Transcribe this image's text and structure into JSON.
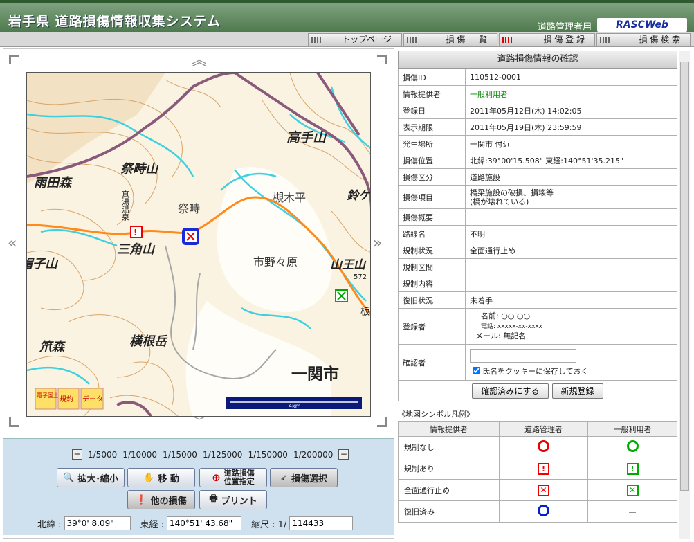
{
  "header": {
    "title": "岩手県 道路損傷情報収集システム",
    "role": "道路管理者用",
    "logo": "RASCWeb"
  },
  "nav": [
    "トップページ",
    "損 傷 一 覧",
    "損 傷 登 録",
    "損 傷 検 索"
  ],
  "map": {
    "labels": [
      "高手山",
      "雨田森",
      "祭畤山",
      "槻木平",
      "鈴ケ",
      "真湯温泉",
      "祭畤",
      "三角山",
      "帽子山",
      "市野々原",
      "山王山",
      "572",
      "板",
      "笊森",
      "横根岳",
      "一関市"
    ],
    "badges": [
      "電子国土",
      "規約",
      "データ"
    ],
    "scale_bar": "4km"
  },
  "scales": [
    "1/5000",
    "1/10000",
    "1/15000",
    "1/125000",
    "1/150000",
    "1/200000"
  ],
  "tools": {
    "zoom": "拡大･縮小",
    "move": "移 動",
    "pos_line1": "道路損傷",
    "pos_line2": "位置指定",
    "select": "損傷選択",
    "other": "他の損傷",
    "print": "プリント"
  },
  "coords": {
    "lat_label": "北緯 :",
    "lat": "39°0' 8.09\"",
    "lon_label": "東経 :",
    "lon": "140°51' 43.68\"",
    "scale_label": "縮尺 : 1/",
    "scale": "114433"
  },
  "info": {
    "title": "道路損傷情報の確認",
    "rows": [
      {
        "k": "損傷ID",
        "v": "110512-0001"
      },
      {
        "k": "情報提供者",
        "v": "一般利用者"
      },
      {
        "k": "登録日",
        "v": "2011年05月12日(木) 14:02:05"
      },
      {
        "k": "表示期限",
        "v": "2011年05月19日(木) 23:59:59"
      },
      {
        "k": "発生場所",
        "v": "一関市 付近"
      },
      {
        "k": "損傷位置",
        "v": "北緯:39°00'15.508\" 東経:140°51'35.215\""
      },
      {
        "k": "損傷区分",
        "v": "道路施設"
      },
      {
        "k": "損傷項目",
        "v": "橋梁施設の破損、損壊等"
      },
      {
        "k": "損傷概要",
        "v": ""
      },
      {
        "k": "路線名",
        "v": "不明"
      },
      {
        "k": "規制状況",
        "v": "全面通行止め"
      },
      {
        "k": "規制区間",
        "v": ""
      },
      {
        "k": "規制内容",
        "v": ""
      },
      {
        "k": "復旧状況",
        "v": "未着手"
      }
    ],
    "item_sub": "(橋が壊れている)",
    "registrant_label": "登録者",
    "registrant_name": "名前: ○○ ○○",
    "registrant_tel": "電話: xxxxx-xx-xxxx",
    "registrant_mail": "メール: 無記名",
    "confirmer_label": "確認者",
    "cookie_label": "氏名をクッキーに保存しておく",
    "confirm_btn": "確認済みにする",
    "new_btn": "新規登録"
  },
  "legend": {
    "title": "《地図シンボル凡例》",
    "headers": [
      "情報提供者",
      "道路管理者",
      "一般利用者"
    ],
    "rows": [
      "規制なし",
      "規制あり",
      "全面通行止め",
      "復旧済み"
    ],
    "dash": "—"
  },
  "colors": {
    "manager": "#e00000",
    "public": "#00aa00",
    "restored": "#0022cc",
    "header_green": "#5f8a5f"
  }
}
